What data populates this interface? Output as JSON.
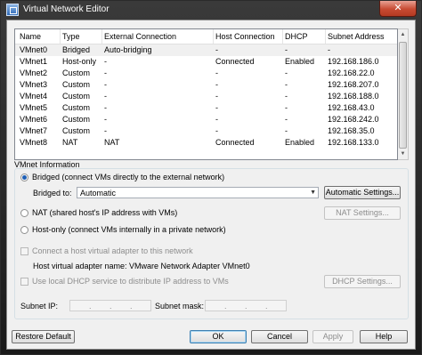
{
  "window": {
    "title": "Virtual Network Editor",
    "close_glyph": "✕"
  },
  "table": {
    "headers": [
      "Name",
      "Type",
      "External Connection",
      "Host Connection",
      "DHCP",
      "Subnet Address"
    ],
    "rows": [
      [
        "VMnet0",
        "Bridged",
        "Auto-bridging",
        "-",
        "-",
        "-"
      ],
      [
        "VMnet1",
        "Host-only",
        "-",
        "Connected",
        "Enabled",
        "192.168.186.0"
      ],
      [
        "VMnet2",
        "Custom",
        "-",
        "-",
        "-",
        "192.168.22.0"
      ],
      [
        "VMnet3",
        "Custom",
        "-",
        "-",
        "-",
        "192.168.207.0"
      ],
      [
        "VMnet4",
        "Custom",
        "-",
        "-",
        "-",
        "192.168.188.0"
      ],
      [
        "VMnet5",
        "Custom",
        "-",
        "-",
        "-",
        "192.168.43.0"
      ],
      [
        "VMnet6",
        "Custom",
        "-",
        "-",
        "-",
        "192.168.242.0"
      ],
      [
        "VMnet7",
        "Custom",
        "-",
        "-",
        "-",
        "192.168.35.0"
      ],
      [
        "VMnet8",
        "NAT",
        "NAT",
        "Connected",
        "Enabled",
        "192.168.133.0"
      ]
    ],
    "selected_row": 0
  },
  "vmnet_info": {
    "group_label": "VMnet Information",
    "bridged_label": "Bridged (connect VMs directly to the external network)",
    "bridged_to_label": "Bridged to:",
    "bridged_to_value": "Automatic",
    "automatic_settings_button": "Automatic Settings...",
    "nat_label": "NAT (shared host's IP address with VMs)",
    "nat_settings_button": "NAT Settings...",
    "host_only_label": "Host-only (connect VMs internally in a private network)",
    "connect_adapter_label": "Connect a host virtual adapter to this network",
    "adapter_name_label": "Host virtual adapter name: VMware Network Adapter VMnet0",
    "dhcp_label": "Use local DHCP service to distribute IP address to VMs",
    "dhcp_settings_button": "DHCP Settings...",
    "subnet_ip_label": "Subnet IP:",
    "subnet_mask_label": "Subnet mask:",
    "selected_mode": "bridged"
  },
  "footer": {
    "restore_default": "Restore Default",
    "ok": "OK",
    "cancel": "Cancel",
    "apply": "Apply",
    "help": "Help"
  },
  "colors": {
    "title_bar": "#2a2a2a",
    "close_button": "#c74a32",
    "dialog_bg": "#f0f0f0",
    "selected_row": "#f0f0f0"
  }
}
